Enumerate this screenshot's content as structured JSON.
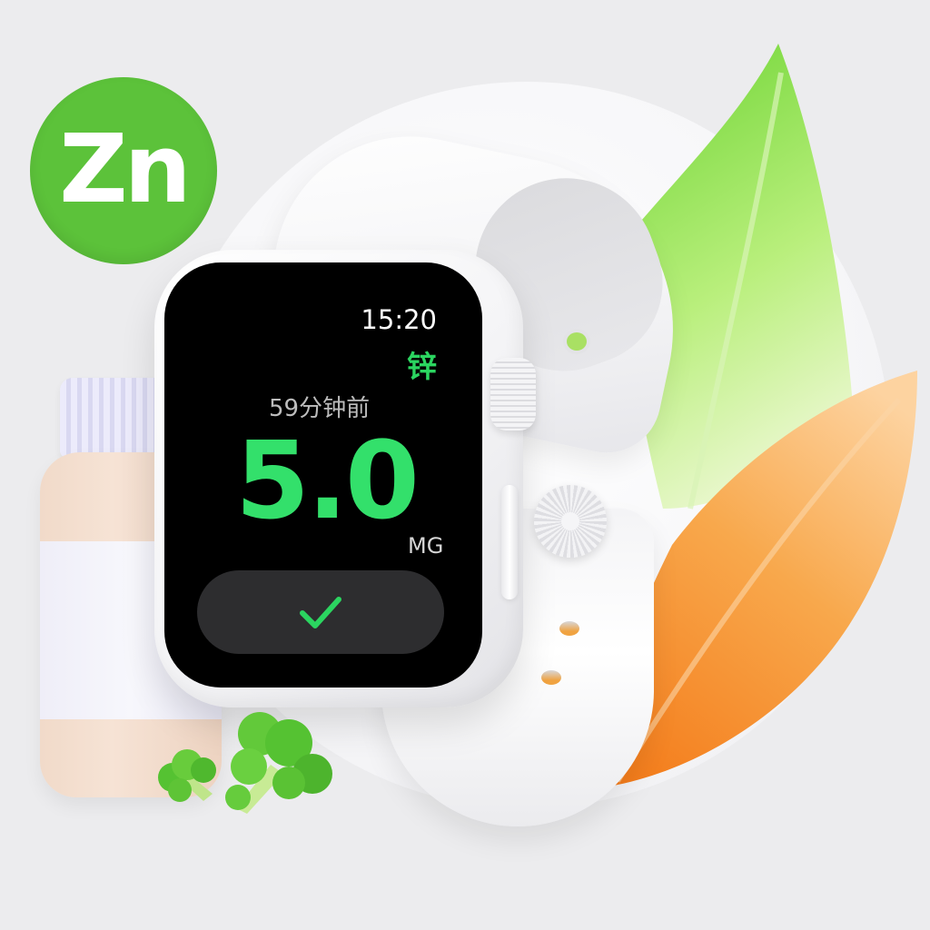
{
  "badge": {
    "text": "Zn"
  },
  "watch": {
    "time": "15:20",
    "mineral": "锌",
    "elapsed": "59分钟前",
    "value": "5.0",
    "unit": "MG"
  },
  "icons": [
    "zn-badge",
    "check-icon",
    "leaf-green",
    "leaf-orange",
    "supplement-bottle",
    "broccoli"
  ],
  "colors": {
    "accent_green": "#33e06b",
    "badge_green": "#5cc23a",
    "leaf_orange": "#f6a040",
    "background": "#ececee"
  }
}
